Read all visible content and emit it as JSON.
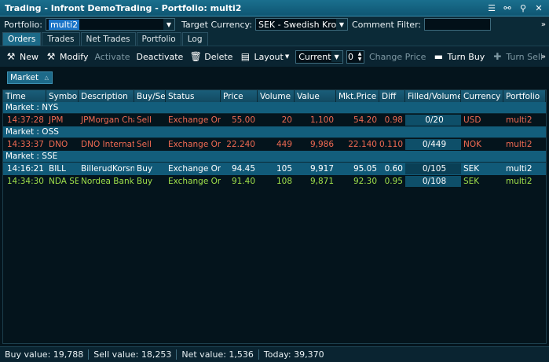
{
  "window": {
    "title": "Trading - Infront DemoTrading - Portfolio: multi2"
  },
  "filter": {
    "portfolio_label": "Portfolio:",
    "portfolio_value": "multi2",
    "currency_label": "Target Currency:",
    "currency_value": "SEK - Swedish Krone",
    "comment_label": "Comment Filter:",
    "comment_value": ""
  },
  "tabs": [
    {
      "label": "Orders",
      "active": true
    },
    {
      "label": "Trades",
      "active": false
    },
    {
      "label": "Net Trades",
      "active": false
    },
    {
      "label": "Portfolio",
      "active": false
    },
    {
      "label": "Log",
      "active": false
    }
  ],
  "toolbar": {
    "new_label": "New",
    "modify_label": "Modify",
    "activate_label": "Activate",
    "deactivate_label": "Deactivate",
    "delete_label": "Delete",
    "layout_label": "Layout",
    "mode_value": "Current",
    "stepper_value": "0",
    "change_price_label": "Change Price",
    "turn_buy_label": "Turn Buy",
    "turn_sell_label": "Turn Sell"
  },
  "grouping": {
    "chip_label": "Market"
  },
  "columns": [
    "Time",
    "Symbol",
    "Description",
    "Buy/Sell",
    "Status",
    "Price",
    "Volume",
    "Value",
    "Mkt.Price",
    "Diff",
    "Filled/Volume",
    "Currency",
    "Portfolio"
  ],
  "groups": [
    {
      "label": "Market : NYS",
      "rows": [
        {
          "time": "14:37:28",
          "symbol": "JPM",
          "description": "JPMorgan Chase",
          "side": "Sell",
          "status": "Exchange Order",
          "price": "55.00",
          "volume": "20",
          "value": "1,100",
          "mkt_price": "54.20",
          "diff": "0.98",
          "filled": "0/20",
          "currency": "USD",
          "portfolio": "multi2",
          "style": "sell"
        }
      ]
    },
    {
      "label": "Market : OSS",
      "rows": [
        {
          "time": "14:33:37",
          "symbol": "DNO",
          "description": "DNO Internationa",
          "side": "Sell",
          "status": "Exchange Order",
          "price": "22.240",
          "volume": "449",
          "value": "9,986",
          "mkt_price": "22.140",
          "diff": "0.110",
          "filled": "0/449",
          "currency": "NOK",
          "portfolio": "multi2",
          "style": "sell"
        }
      ]
    },
    {
      "label": "Market : SSE",
      "rows": [
        {
          "time": "14:16:21",
          "symbol": "BILL",
          "description": "BillerudKorsnäs A",
          "side": "Buy",
          "status": "Exchange Order",
          "price": "94.45",
          "volume": "105",
          "value": "9,917",
          "mkt_price": "95.05",
          "diff": "0.60",
          "filled": "0/105",
          "currency": "SEK",
          "portfolio": "multi2",
          "style": "buy-sel"
        },
        {
          "time": "14:34:30",
          "symbol": "NDA SEK",
          "description": "Nordea Bank AB",
          "side": "Buy",
          "status": "Exchange Order",
          "price": "91.40",
          "volume": "108",
          "value": "9,871",
          "mkt_price": "92.30",
          "diff": "0.95",
          "filled": "0/108",
          "currency": "SEK",
          "portfolio": "multi2",
          "style": "buy"
        }
      ]
    }
  ],
  "status": {
    "buy_value": "Buy value: 19,788",
    "sell_value": "Sell value: 18,253",
    "net_value": "Net value: 1,536",
    "today": "Today: 39,370"
  },
  "colors": {
    "sell": "#f06a52",
    "buy": "#9fe04a",
    "header": "#1a5e7a",
    "background": "#04141c"
  }
}
